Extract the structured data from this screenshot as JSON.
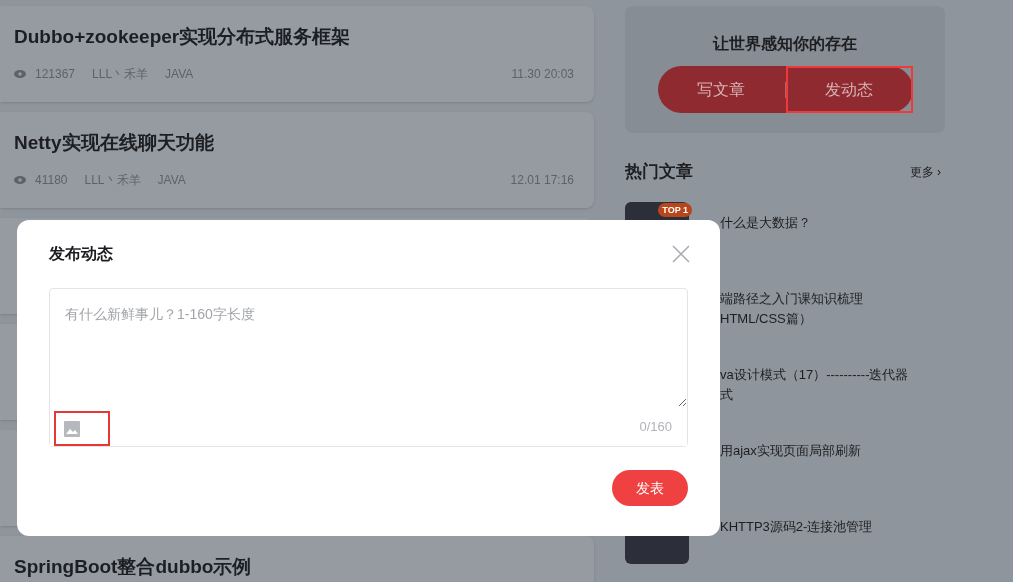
{
  "articles": [
    {
      "title": "Dubbo+zookeeper实现分布式服务框架",
      "views": "121367",
      "author": "LLL丶禾羊",
      "category": "JAVA",
      "time": "11.30 20:03"
    },
    {
      "title": "Netty实现在线聊天功能",
      "views": "41180",
      "author": "LLL丶禾羊",
      "category": "JAVA",
      "time": "12.01 17:16"
    },
    {
      "hidden": true
    },
    {
      "hidden": true
    },
    {
      "hidden": true
    },
    {
      "title": "SpringBoot整合dubbo示例"
    }
  ],
  "promo": {
    "heading": "让世界感知你的存在",
    "buttons": [
      {
        "label": "写文章",
        "highlighted": false
      },
      {
        "label": "发动态",
        "highlighted": true
      }
    ]
  },
  "hot": {
    "title": "热门文章",
    "more": "更多",
    "more_icon": "›",
    "items": [
      {
        "lines": [
          "什么是大数据？"
        ],
        "badge": "TOP 1"
      },
      {
        "lines": [
          "端路径之入门课知识梳理",
          "HTML/CSS篇）"
        ]
      },
      {
        "lines": [
          "va设计模式（17）----------迭代器",
          "式"
        ]
      },
      {
        "lines": [
          "用ajax实现页面局部刷新"
        ]
      },
      {
        "lines": [
          "KHTTP3源码2-连接池管理"
        ]
      }
    ]
  },
  "dialog": {
    "title": "发布动态",
    "placeholder": "有什么新鲜事儿？1-160字长度",
    "counter": "0/160",
    "image_highlighted": true,
    "submit": "发表"
  }
}
